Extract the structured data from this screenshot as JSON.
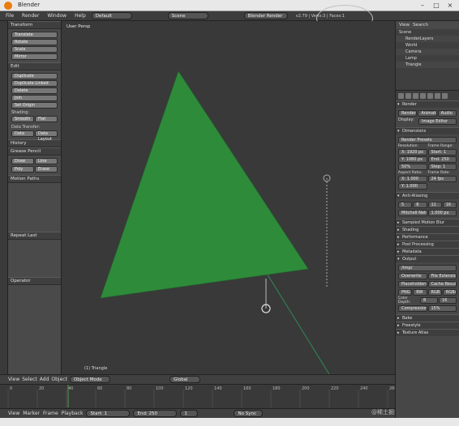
{
  "window": {
    "title": "Blender"
  },
  "topbar": {
    "menus": [
      "File",
      "Render",
      "Window",
      "Help"
    ],
    "layout": "Default",
    "scene": "Scene",
    "engine": "Blender Render",
    "info": "v2.79 | Verts:3 | Faces:1"
  },
  "toolshelf": {
    "transform_header": "Transform",
    "transform_buttons": [
      "Translate",
      "Rotate",
      "Scale",
      "Mirror"
    ],
    "edit_header": "Edit",
    "edit_buttons": [
      "Duplicate",
      "Duplicate Linked",
      "Delete",
      "Join",
      "Set Origin"
    ],
    "shading_label": "Shading:",
    "shading_buttons": [
      "Smooth",
      "Flat"
    ],
    "data_label": "Data Transfer:",
    "data_buttons": [
      "Data",
      "Data Layout"
    ],
    "history_header": "History",
    "grease_header": "Grease Pencil",
    "grease_buttons": [
      "Draw",
      "Line",
      "Poly",
      "Erase"
    ],
    "motion_header": "Motion Paths",
    "repeat_header": "Repeat Last",
    "operator_header": "Operator"
  },
  "viewport": {
    "label": "User Persp",
    "object_name": "(1) Triangle"
  },
  "colors": {
    "triangle": "#2e8b3a",
    "viewport_bg": "#393939"
  },
  "header3d": {
    "menus": [
      "View",
      "Select",
      "Add",
      "Object"
    ],
    "mode": "Object Mode",
    "pivot": "Global"
  },
  "timeline": {
    "ticks": [
      "0",
      "20",
      "40",
      "60",
      "80",
      "100",
      "120",
      "140",
      "160",
      "180",
      "200",
      "220",
      "240",
      "260"
    ],
    "menus": [
      "View",
      "Marker",
      "Frame",
      "Playback"
    ],
    "start_label": "Start:",
    "start": "1",
    "end_label": "End:",
    "end": "250",
    "current": "1",
    "sync": "No Sync"
  },
  "outliner": {
    "menus": [
      "View",
      "Search"
    ],
    "items": [
      "Scene",
      "RenderLayers",
      "World",
      "Camera",
      "Lamp",
      "Triangle"
    ]
  },
  "properties": {
    "render_header": "Render",
    "render_buttons": [
      "Render",
      "Animation",
      "Audio"
    ],
    "display_label": "Display:",
    "display_value": "Image Editor",
    "dimensions_header": "Dimensions",
    "presets": "Render Presets",
    "resolution_label": "Resolution:",
    "res_x": "X: 1920 px",
    "res_y": "Y: 1080 px",
    "res_pct": "50%",
    "frame_range_label": "Frame Range:",
    "frame_start": "Start: 1",
    "frame_end": "End: 250",
    "frame_step": "Step: 1",
    "aspect_label": "Aspect Ratio:",
    "aspect_x": "X: 1.000",
    "aspect_y": "Y: 1.000",
    "fps_label": "Frame Rate:",
    "fps": "24 fps",
    "aa_header": "Anti-Aliasing",
    "aa_values": [
      "5",
      "8",
      "11",
      "16"
    ],
    "aa_filter": "Mitchell-Netravali",
    "aa_size": "1.000 px",
    "sampled_header": "Sampled Motion Blur",
    "collapsed": [
      "Shading",
      "Performance",
      "Post Processing",
      "Metadata"
    ],
    "output_header": "Output",
    "output_path": "/tmp/",
    "overwrite": "Overwrite",
    "file_ext": "File Extensions",
    "placeholders": "Placeholders",
    "cache": "Cache Result",
    "format": "PNG",
    "bw": "BW",
    "rgb": "RGB",
    "rgba": "RGBA",
    "color_depth_label": "Color Depth:",
    "depth_8": "8",
    "depth_16": "16",
    "compression_label": "Compression:",
    "compression": "15%",
    "bake_header": "Bake",
    "freestyle_header": "Freestyle",
    "texture_atlas_header": "Texture Atlas"
  },
  "watermark": "@稀土掘金技术社区"
}
